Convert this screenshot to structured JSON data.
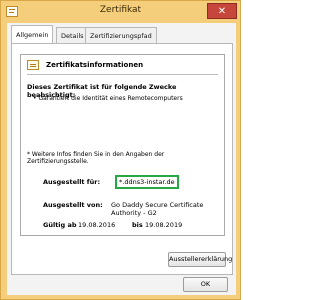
{
  "window": {
    "title": "Zertifikat",
    "close_glyph": "✕"
  },
  "tabs": [
    {
      "label": "Allgemein",
      "active": true
    },
    {
      "label": "Details",
      "active": false
    },
    {
      "label": "Zertifizierungspfad",
      "active": false
    }
  ],
  "general": {
    "info_heading": "Zertifikatsinformationen",
    "purpose_heading": "Dieses Zertifikat ist für folgende Zwecke beabsichtigt:",
    "purposes": [
      "• Garantiert die Identität eines Remotecomputers"
    ],
    "more_info_note": "* Weitere Infos finden Sie in den Angaben der Zertifizierungsstelle.",
    "issued_to_label": "Ausgestellt für:",
    "issued_to_value": "*.ddns3-instar.de",
    "issued_by_label": "Ausgestellt von:",
    "issued_by_value": "Go Daddy Secure Certificate Authority - G2",
    "valid_from_label": "Gültig ab",
    "valid_from_value": "19.08.2016",
    "valid_to_label": "bis",
    "valid_to_value": "19.08.2019",
    "issuer_statement_button": "Ausstellererklärung"
  },
  "footer": {
    "ok_button": "OK"
  },
  "colors": {
    "frame": "#f4ce7a",
    "close": "#c7463b",
    "highlight": "#28a745"
  },
  "icons": {
    "title": "certificate-icon",
    "info": "certificate-icon",
    "close": "close-icon"
  }
}
